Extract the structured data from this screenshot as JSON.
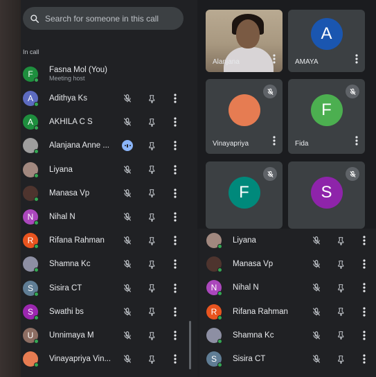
{
  "search": {
    "placeholder": "Search for someone in this call"
  },
  "in_call_label": "In call",
  "host": {
    "name": "Fasna Mol (You)",
    "role": "Meeting host",
    "initial": "F",
    "color": "#1e8e3e"
  },
  "participants": [
    {
      "name": "Adithya Ks",
      "initial": "A",
      "color": "#5c6bc0"
    },
    {
      "name": "AKHILA C S",
      "initial": "A",
      "color": "#1e8e3e"
    },
    {
      "name": "Alanjana Anne ...",
      "initial": "",
      "color": "#9e9e9e",
      "speaking": true
    },
    {
      "name": "Liyana",
      "initial": "",
      "color": "#a1887f"
    },
    {
      "name": "Manasa Vp",
      "initial": "",
      "color": "#4e342e"
    },
    {
      "name": "Nihal N",
      "initial": "N",
      "color": "#ab47bc"
    },
    {
      "name": "Rifana Rahman",
      "initial": "R",
      "color": "#e8541f"
    },
    {
      "name": "Shamna Kc",
      "initial": "",
      "color": "#8d8fa3"
    },
    {
      "name": "Sisira CT",
      "initial": "S",
      "color": "#5f7d95"
    },
    {
      "name": "Swathi bs",
      "initial": "S",
      "color": "#9c27b0"
    },
    {
      "name": "Unnimaya M",
      "initial": "U",
      "color": "#8d6e63"
    },
    {
      "name": "Vinayapriya Vin...",
      "initial": "",
      "color": "#e67c52"
    }
  ],
  "tiles": [
    {
      "name": "Alanjana",
      "type": "video"
    },
    {
      "name": "AMAYA",
      "initial": "A",
      "color": "#1a56b0"
    },
    {
      "name": "Vinayapriya",
      "initial": "",
      "color": "#e67c52"
    },
    {
      "name": "Fida",
      "initial": "F",
      "color": "#4caf50"
    },
    {
      "name": "",
      "initial": "F",
      "color": "#00897b"
    },
    {
      "name": "",
      "initial": "S",
      "color": "#8e24aa"
    }
  ],
  "right_list": [
    {
      "name": "Liyana",
      "initial": "",
      "color": "#a1887f"
    },
    {
      "name": "Manasa Vp",
      "initial": "",
      "color": "#4e342e"
    },
    {
      "name": "Nihal N",
      "initial": "N",
      "color": "#ab47bc"
    },
    {
      "name": "Rifana Rahman",
      "initial": "R",
      "color": "#e8541f"
    },
    {
      "name": "Shamna Kc",
      "initial": "",
      "color": "#8d8fa3"
    },
    {
      "name": "Sisira CT",
      "initial": "S",
      "color": "#5f7d95"
    }
  ]
}
